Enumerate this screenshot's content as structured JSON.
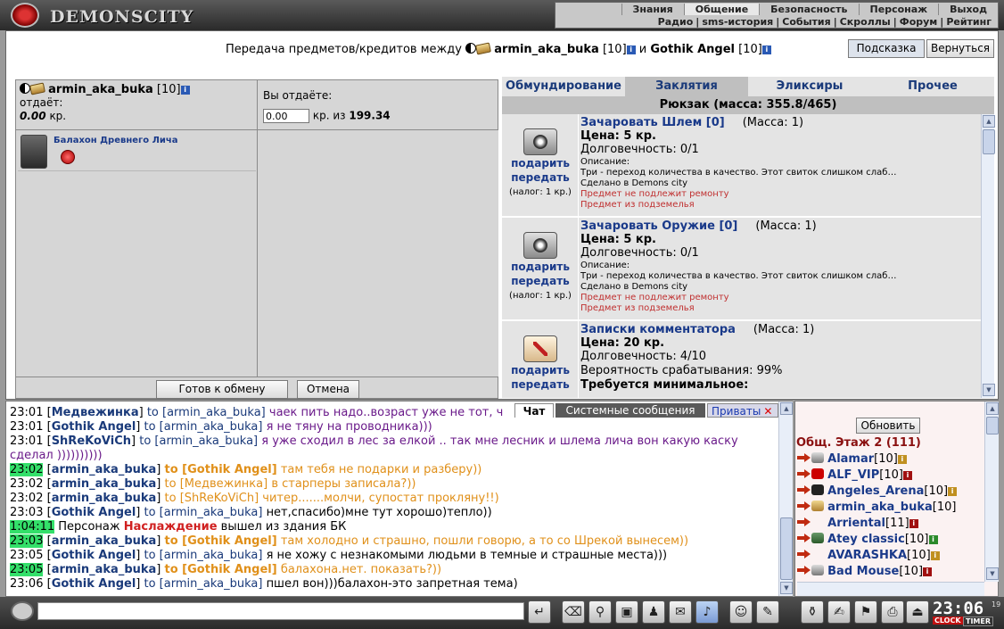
{
  "header": {
    "logo_text": "DEMONSCITY",
    "menu_top": [
      "Знания",
      "Общение",
      "Безопасность",
      "Персонаж",
      "Выход"
    ],
    "menu_top_active": "Общение",
    "menu_bottom": [
      "Радио",
      "sms-история",
      "События",
      "Скроллы",
      "Форум",
      "Рейтинг"
    ]
  },
  "title": {
    "prefix": "Передача предметов/кредитов между",
    "player1": "armin_aka_buka",
    "player1_level": "[10]",
    "and": "и",
    "player2": "Gothik Angel",
    "player2_level": "[10]"
  },
  "buttons": {
    "hint": "Подсказка",
    "back": "Вернуться",
    "ready": "Готов к обмену",
    "cancel": "Отмена",
    "refresh": "Обновить"
  },
  "trade": {
    "left_name": "armin_aka_buka",
    "left_level": "[10]",
    "left_gives_label": "отдаёт:",
    "left_amount": "0.00",
    "left_currency": "кр.",
    "right_label": "Вы отдаёте:",
    "credit_value": "0.00",
    "credit_of": "кр. из",
    "credit_total": "199.34",
    "offer_item_name": "Балахон Древнего Лича"
  },
  "inventory": {
    "tabs": [
      "Обмундирование",
      "Заклятия",
      "Эликсиры",
      "Прочее"
    ],
    "active_tab": "Заклятия",
    "backpack": "Рюкзак (масса: 355.8/465)",
    "items": [
      {
        "action1": "подарить",
        "action2": "передать",
        "tax": "(налог: 1 кр.)",
        "name": "Зачаровать Шлем [0]",
        "mass": "(Масса: 1)",
        "price": "Цена: 5 кр.",
        "durability": "Долговечность: 0/1",
        "desc_label": "Описание:",
        "desc": "Три - переход количества в качество. Этот свиток слишком слаб…",
        "made": "Сделано в Demons city",
        "warn1": "Предмет не подлежит ремонту",
        "warn2": "Предмет из подземелья"
      },
      {
        "action1": "подарить",
        "action2": "передать",
        "tax": "(налог: 1 кр.)",
        "name": "Зачаровать Оружие [0]",
        "mass": "(Масса: 1)",
        "price": "Цена: 5 кр.",
        "durability": "Долговечность: 0/1",
        "desc_label": "Описание:",
        "desc": "Три - переход количества в качество. Этот свиток слишком слаб…",
        "made": "Сделано в Demons city",
        "warn1": "Предмет не подлежит ремонту",
        "warn2": "Предмет из подземелья"
      },
      {
        "action1": "подарить",
        "action2": "передать",
        "name": "Записки комментатора",
        "mass": "(Масса: 1)",
        "price": "Цена: 20 кр.",
        "durability": "Долговечность: 4/10",
        "chance": "Вероятность срабатывания: 99%",
        "required": "Требуется минимальное:"
      }
    ]
  },
  "chat": {
    "tabs": {
      "chat": "Чат",
      "system": "Системные сообщения",
      "private": "Приваты"
    },
    "lines": [
      {
        "time": "23:01",
        "who": "Медвежинка",
        "to": "to [armin_aka_buka]",
        "text": "чаек пить надо..возраст уже не тот, ч",
        "style": "purple"
      },
      {
        "time": "23:01",
        "who": "Gothik Angel",
        "to": "to [armin_aka_buka]",
        "text": "я не тяну на проводника)))",
        "style": "purple"
      },
      {
        "time": "23:01",
        "who": "ShReKoViCh",
        "to": "to [armin_aka_buka]",
        "text": "я уже сходил в лес за елкой .. так мне лесник и шлема лича вон какую каску сделал ))))))))))",
        "style": "purple",
        "wrap": true
      },
      {
        "time": "23:02",
        "hl": true,
        "who": "armin_aka_buka",
        "to": "to [Gothik Angel]",
        "text": "там тебя не подарки и разберу))",
        "style": "orange"
      },
      {
        "time": "23:02",
        "who": "armin_aka_buka",
        "to": "to [Медвежинка]",
        "text": "в старперы записала?))",
        "style": "orange-light"
      },
      {
        "time": "23:02",
        "who": "armin_aka_buka",
        "to": "to [ShReKoViCh]",
        "text": "читер.......молчи, супостат прокляну!!)",
        "style": "orange-light"
      },
      {
        "time": "23:03",
        "who": "Gothik Angel",
        "to": "to [armin_aka_buka]",
        "text": "нет,спасибо)мне тут хорошо)тепло))",
        "style": "black"
      },
      {
        "time": "1:04:11",
        "hl": true,
        "system": true,
        "pre": "Персонаж",
        "name": "Наслаждение",
        "post": "вышел из здания БК"
      },
      {
        "time": "23:03",
        "hl": true,
        "who": "armin_aka_buka",
        "to": "to [Gothik Angel]",
        "text": "там холодно и страшно, пошли говорю, а то со Шрекой вынесем))",
        "style": "orange"
      },
      {
        "time": "23:05",
        "who": "Gothik Angel",
        "to": "to [armin_aka_buka]",
        "text": "я не хожу с незнакомыми людьми в темные и страшные места)))",
        "style": "black"
      },
      {
        "time": "23:05",
        "hl": true,
        "who": "armin_aka_buka",
        "to": "to [Gothik Angel]",
        "text": "балахона.нет. показать?))",
        "style": "orange"
      },
      {
        "time": "23:06",
        "who": "Gothik Angel",
        "to": "to [armin_aka_buka]",
        "text": "пшел вон)))балахон-это запретная тема)",
        "style": "black"
      }
    ]
  },
  "online": {
    "title": "Общ. Этаж 2 (111)",
    "players": [
      {
        "name": "Alamar",
        "level": "[10]",
        "info": "gold"
      },
      {
        "name": "ALF_VIP",
        "level": "[10]",
        "info": "red"
      },
      {
        "name": "Angeles_Arena",
        "level": "[10]",
        "info": "gold"
      },
      {
        "name": "armin_aka_buka",
        "level": "[10]",
        "info": ""
      },
      {
        "name": "Arriental",
        "level": "[11]",
        "info": "red"
      },
      {
        "name": "Atey classic",
        "level": "[10]",
        "info": "green"
      },
      {
        "name": "AVARASHKA",
        "level": "[10]",
        "info": "gold"
      },
      {
        "name": "Bad Mouse",
        "level": "[10]",
        "info": "red"
      }
    ]
  },
  "clock": {
    "time": "23:06",
    "seconds": "19",
    "label1": "CLOCK",
    "label2": "TIMER"
  }
}
